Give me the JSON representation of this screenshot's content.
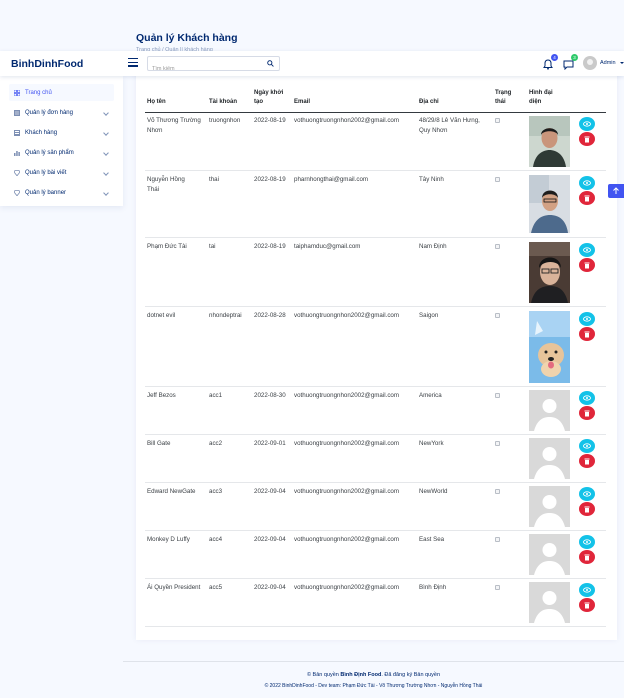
{
  "page": {
    "title": "Quản lý Khách hàng",
    "breadcrumb": "Trang chủ / Quản lí khách hàng"
  },
  "header": {
    "logo": "BinhDinhFood",
    "search_placeholder": "Tìm kiếm",
    "notifications_count": "4",
    "messages_count": "3",
    "user_name": "Admin",
    "icons": {
      "menu": "hamburger-icon",
      "search": "search-icon",
      "notifications": "bell-icon",
      "messages": "chat-icon"
    }
  },
  "sidebar": {
    "items": [
      {
        "label": "Trang chủ",
        "icon": "grid-icon",
        "active": true
      },
      {
        "label": "Quản lý đơn hàng",
        "icon": "orders-icon"
      },
      {
        "label": "Khách hàng",
        "icon": "customers-icon"
      },
      {
        "label": "Quản lý sản phẩm",
        "icon": "bar-chart-icon"
      },
      {
        "label": "Quản lý bài viết",
        "icon": "gem-icon"
      },
      {
        "label": "Quản lý banner",
        "icon": "gem-icon"
      }
    ]
  },
  "table": {
    "headers": {
      "name": "Họ tên",
      "account": "Tài khoản",
      "created": "Ngày khởi tạo",
      "email": "Email",
      "address": "Địa chỉ",
      "status": "Trạng thái",
      "avatar": "Hình đại diện"
    },
    "rows": [
      {
        "name": "Võ Thương Trường Nhơn",
        "account": "truongnhon",
        "created": "2022-08-19",
        "email": "vothuongtruongnhon2002@gmail.com",
        "address": "48/29/8 Lê Văn Hưng, Quy Nhơn"
      },
      {
        "name": "Nguyễn Hồng Thái",
        "account": "thai",
        "created": "2022-08-19",
        "email": "pharnhongthai@gmail.com",
        "address": "Tây Ninh"
      },
      {
        "name": "Phạm Đức Tài",
        "account": "tai",
        "created": "2022-08-19",
        "email": "taiphamduc@gmail.com",
        "address": "Nam Định"
      },
      {
        "name": "dotnet evil",
        "account": "nhondeptrai",
        "created": "2022-08-28",
        "email": "vothuongtruongnhon2002@gmail.com",
        "address": "Saigon"
      },
      {
        "name": "Jeff Bezos",
        "account": "acc1",
        "created": "2022-08-30",
        "email": "vothuongtruongnhon2002@gmail.com",
        "address": "America"
      },
      {
        "name": "Bill Gate",
        "account": "acc2",
        "created": "2022-09-01",
        "email": "vothuongtruongnhon2002@gmail.com",
        "address": "NewYork"
      },
      {
        "name": "Edward NewGate",
        "account": "acc3",
        "created": "2022-09-04",
        "email": "vothuongtruongnhon2002@gmail.com",
        "address": "NewWorld"
      },
      {
        "name": "Monkey D Luffy",
        "account": "acc4",
        "created": "2022-09-04",
        "email": "vothuongtruongnhon2002@gmail.com",
        "address": "East Sea"
      },
      {
        "name": "Ái Quyền President",
        "account": "acc5",
        "created": "2022-09-04",
        "email": "vothuongtruongnhon2002@gmail.com",
        "address": "Bình Định"
      }
    ],
    "row_icons": {
      "view": "eye-icon",
      "delete": "trash-icon"
    }
  },
  "footer": {
    "copyright_prefix": "© Bản quyền ",
    "brand": "Bình Định Food",
    "copyright_suffix": ". Đã đăng ký Bản quyền",
    "credits": "© 2022 BinhDinhFood - Dev team: Phạm Đức Tài - Võ Thương Trường Nhơn - Nguyễn Hồng Thái"
  },
  "colors": {
    "brand": "#012970",
    "accent": "#4154f1",
    "view_button": "#13c2e8",
    "delete_button": "#e0263a",
    "badge_blue": "#4154f1",
    "badge_green": "#2eca6a"
  }
}
